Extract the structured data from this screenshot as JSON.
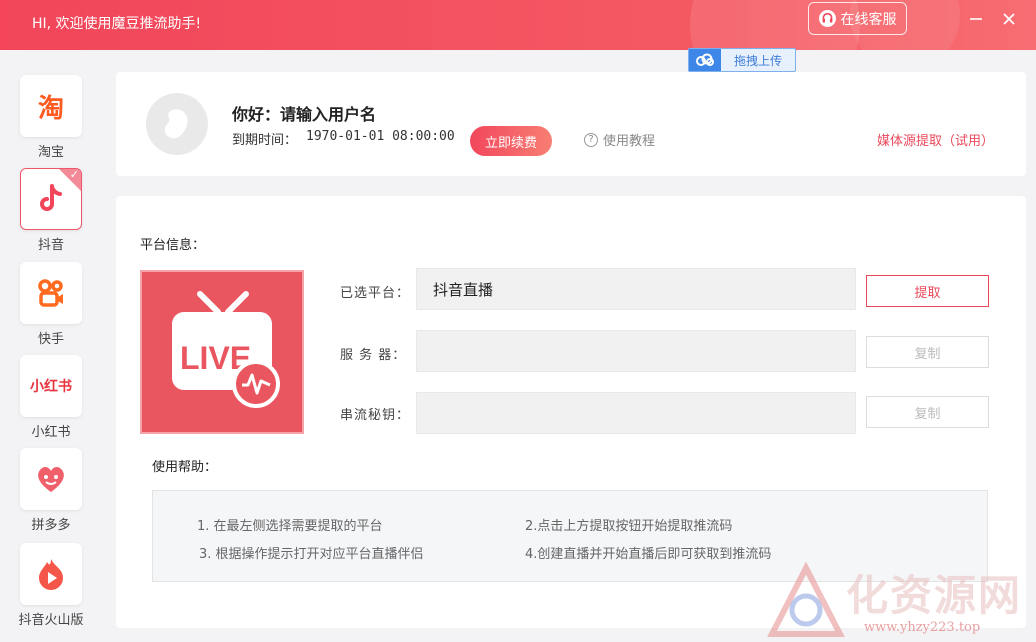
{
  "titlebar": {
    "greeting": "HI, 欢迎使用魔豆推流助手!",
    "service_label": "在线客服"
  },
  "upload": {
    "label": "拖拽上传"
  },
  "sidebar": {
    "items": [
      {
        "label": "淘宝",
        "icon": "taobao-icon",
        "glyph": "淘"
      },
      {
        "label": "抖音",
        "icon": "douyin-icon",
        "glyph": "♪",
        "active": true
      },
      {
        "label": "快手",
        "icon": "kuaishou-icon",
        "glyph": ""
      },
      {
        "label": "小红书",
        "icon": "xiaohongshu-icon",
        "glyph": "小红书"
      },
      {
        "label": "拼多多",
        "icon": "pinduoduo-icon",
        "glyph": ""
      },
      {
        "label": "抖音火山版",
        "icon": "huoshan-icon",
        "glyph": ""
      }
    ]
  },
  "user": {
    "hello": "你好：请输入用户名",
    "expire_label": "到期时间：",
    "expire_value": "1970-01-01 08:00:00",
    "renew_label": "立即续费",
    "tutorial_label": "使用教程",
    "media_link": "媒体源提取（试用）"
  },
  "platform": {
    "section_title": "平台信息：",
    "live_text": "LIVE",
    "selected_label": "已选平台：",
    "selected_value": "抖音直播",
    "server_label": "服 务 器：",
    "server_value": "",
    "key_label": "串流秘钥：",
    "key_value": "",
    "extract_label": "提取",
    "copy_label": "复制"
  },
  "help": {
    "section_title": "使用帮助：",
    "lines": [
      "1. 在最左侧选择需要提取的平台",
      "2.点击上方提取按钮开始提取推流码",
      "3. 根据操作提示打开对应平台直播伴侣",
      "4.创建直播并开始直播后即可获取到推流码"
    ]
  },
  "watermark": {
    "text": "化资源网",
    "url": "www.yhzy223.top"
  },
  "colors": {
    "accent": "#f2455a",
    "live_bg": "#e9565f",
    "link_blue": "#3e86e8"
  }
}
